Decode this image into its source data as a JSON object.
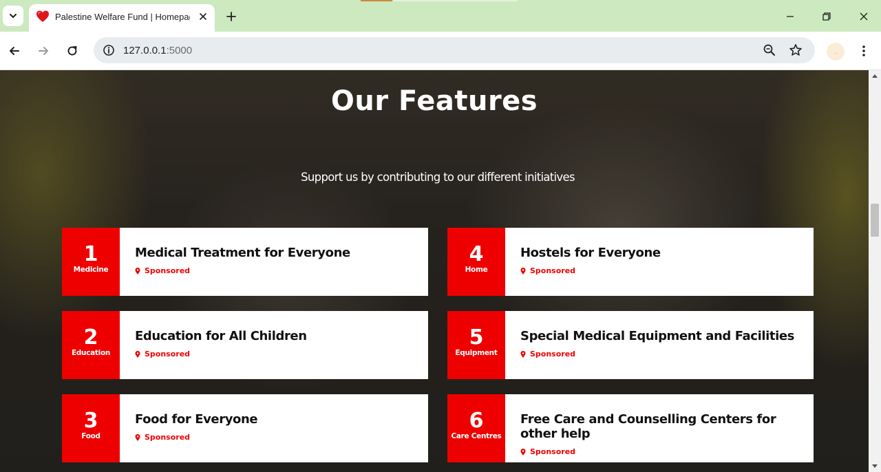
{
  "browser": {
    "tab_title": "Palestine Welfare Fund | Homepage",
    "url_host": "127.0.0.1",
    "url_port": ":5000",
    "profile_initial": "..",
    "icons": {
      "tab_search": "chevron-down-icon",
      "favicon": "heart-icon",
      "close_tab": "close-icon",
      "new_tab": "plus-icon",
      "minimize": "minimize-icon",
      "restore": "restore-icon",
      "close_window": "close-icon",
      "back": "arrow-left-icon",
      "forward": "arrow-right-icon",
      "reload": "reload-icon",
      "site_info": "info-icon",
      "zoom": "zoom-icon",
      "bookmark": "star-icon",
      "menu": "kebab-menu-icon"
    },
    "colors": {
      "tabstrip": "#cde9c0",
      "omnibox": "#e9ecef"
    }
  },
  "hero": {
    "title": "Our Features",
    "subtitle": "Support us by contributing to our different initiatives"
  },
  "features": [
    {
      "number": "1",
      "category": "Medicine",
      "title": "Medical Treatment for Everyone",
      "tag": "Sponsored"
    },
    {
      "number": "4",
      "category": "Home",
      "title": "Hostels for Everyone",
      "tag": "Sponsored"
    },
    {
      "number": "2",
      "category": "Education",
      "title": "Education for All Children",
      "tag": "Sponsored"
    },
    {
      "number": "5",
      "category": "Equipment",
      "title": "Special Medical Equipment and Facilities",
      "tag": "Sponsored"
    },
    {
      "number": "3",
      "category": "Food",
      "title": "Food for Everyone",
      "tag": "Sponsored"
    },
    {
      "number": "6",
      "category": "Care Centres",
      "title": "Free Care and Counselling Centers for other help",
      "tag": "Sponsored"
    }
  ],
  "theme": {
    "accent": "#ee0000",
    "card_background": "#ffffff"
  }
}
